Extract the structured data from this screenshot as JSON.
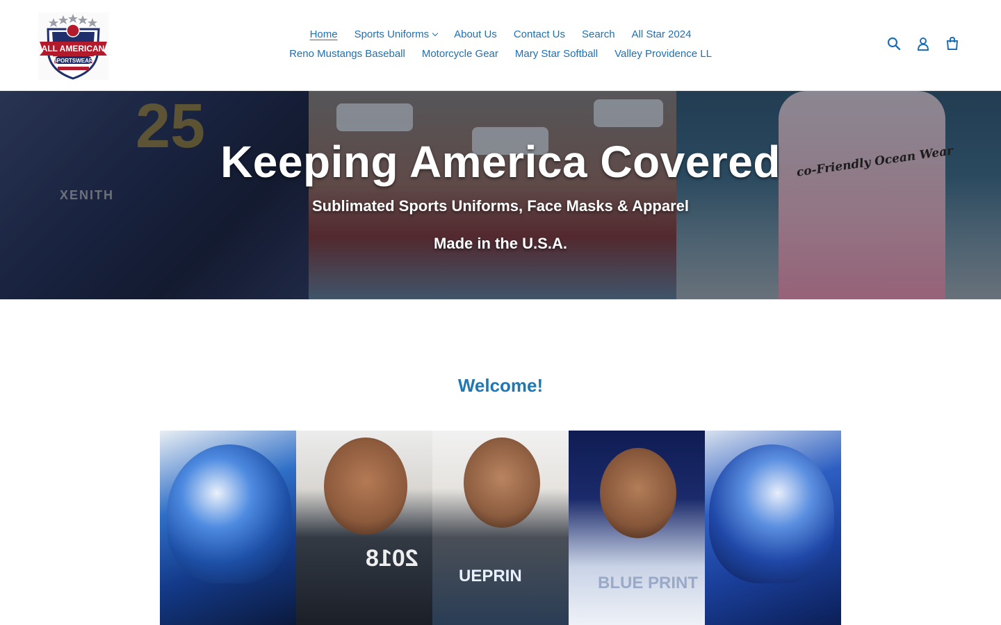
{
  "header": {
    "logo": {
      "alt": "All American Sportswear",
      "line1": "ALL AMERICAN",
      "line2": "SPORTSWEAR",
      "colors": {
        "red": "#b31b2c",
        "navy": "#1f2f6b",
        "silver": "#9a9ea6"
      }
    },
    "nav": {
      "row1": [
        {
          "label": "Home",
          "active": true
        },
        {
          "label": "Sports Uniforms",
          "dropdown": true
        },
        {
          "label": "About Us"
        },
        {
          "label": "Contact Us"
        },
        {
          "label": "Search"
        },
        {
          "label": "All Star 2024"
        }
      ],
      "row2": [
        {
          "label": "Reno Mustangs Baseball"
        },
        {
          "label": "Motorcycle Gear"
        },
        {
          "label": "Mary Star Softball"
        },
        {
          "label": "Valley Providence LL"
        }
      ]
    },
    "icons": [
      "search-icon",
      "account-icon",
      "cart-icon"
    ],
    "accent_color": "#1f6fb2"
  },
  "hero": {
    "title": "Keeping America Covered",
    "subtitle": "Sublimated Sports Uniforms, Face Masks & Apparel",
    "tagline": "Made in the U.S.A.",
    "image_text": {
      "jersey_number": "25",
      "belt_brand": "XENITH",
      "tank_print": "co-Friendly Ocean Wear"
    }
  },
  "welcome": {
    "heading": "Welcome!",
    "color": "#1f78b4"
  },
  "gallery": {
    "tile_texts": [
      "",
      "2018",
      "UEPRIN",
      "BLUE PRINT",
      ""
    ]
  }
}
